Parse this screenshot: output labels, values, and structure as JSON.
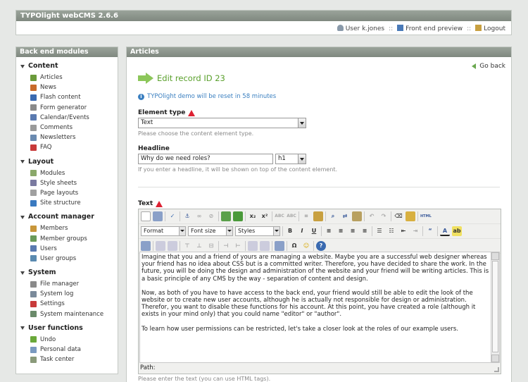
{
  "app": {
    "title": "TYPOlight webCMS 2.6.6"
  },
  "header": {
    "user_label": "User k.jones",
    "frontend_label": "Front end preview",
    "logout_label": "Logout",
    "sep": "::"
  },
  "sidebar": {
    "title": "Back end modules",
    "groups": [
      {
        "title": "Content",
        "items": [
          {
            "label": "Articles",
            "icon": "articles-icon",
            "color": "#6a9a3a"
          },
          {
            "label": "News",
            "icon": "news-icon",
            "color": "#c86a2a"
          },
          {
            "label": "Flash content",
            "icon": "flash-icon",
            "color": "#3a6ab0"
          },
          {
            "label": "Form generator",
            "icon": "form-icon",
            "color": "#8a8a8a"
          },
          {
            "label": "Calendar/Events",
            "icon": "calendar-icon",
            "color": "#5a7ab0"
          },
          {
            "label": "Comments",
            "icon": "comments-icon",
            "color": "#9a9a9a"
          },
          {
            "label": "Newsletters",
            "icon": "newsletter-icon",
            "color": "#6a8ab0"
          },
          {
            "label": "FAQ",
            "icon": "faq-icon",
            "color": "#c83a3a"
          }
        ]
      },
      {
        "title": "Layout",
        "items": [
          {
            "label": "Modules",
            "icon": "modules-icon",
            "color": "#8aa86a"
          },
          {
            "label": "Style sheets",
            "icon": "stylesheet-icon",
            "color": "#7a7aa0"
          },
          {
            "label": "Page layouts",
            "icon": "layout-icon",
            "color": "#a0a0a0"
          },
          {
            "label": "Site structure",
            "icon": "globe-icon",
            "color": "#3a7ac0"
          }
        ]
      },
      {
        "title": "Account manager",
        "items": [
          {
            "label": "Members",
            "icon": "member-icon",
            "color": "#c8963a"
          },
          {
            "label": "Member groups",
            "icon": "member-groups-icon",
            "color": "#6a9a5a"
          },
          {
            "label": "Users",
            "icon": "user-icon",
            "color": "#5a7ab0"
          },
          {
            "label": "User groups",
            "icon": "user-groups-icon",
            "color": "#5a8ab0"
          }
        ]
      },
      {
        "title": "System",
        "items": [
          {
            "label": "File manager",
            "icon": "folder-icon",
            "color": "#8a8a8a"
          },
          {
            "label": "System log",
            "icon": "log-icon",
            "color": "#7a8a9a"
          },
          {
            "label": "Settings",
            "icon": "settings-icon",
            "color": "#c83a3a"
          },
          {
            "label": "System maintenance",
            "icon": "maintenance-icon",
            "color": "#6a8a6a"
          }
        ]
      },
      {
        "title": "User functions",
        "items": [
          {
            "label": "Undo",
            "icon": "undo-icon",
            "color": "#6aa83a"
          },
          {
            "label": "Personal data",
            "icon": "personal-data-icon",
            "color": "#7a9ac0"
          },
          {
            "label": "Task center",
            "icon": "task-icon",
            "color": "#8a9a7a"
          }
        ]
      }
    ]
  },
  "main": {
    "title": "Articles",
    "goback_label": "Go back",
    "edit_title": "Edit record ID 23",
    "info_text": "TYPOlight demo will be reset in 58 minutes",
    "element_type": {
      "label": "Element type",
      "value": "Text",
      "hint": "Please choose the content element type."
    },
    "headline": {
      "label": "Headline",
      "value": "Why do we need roles?",
      "level": "h1",
      "hint": "If you enter a headline, it will be shown on top of the content element."
    },
    "text": {
      "label": "Text",
      "format_select": "Format",
      "fontsize_select": "Font size",
      "styles_select": "Styles",
      "paragraphs": [
        "Imagine that you and a friend of yours are managing a website. Maybe you are a successful web designer whereas your friend has no idea about CSS but is a committed writer. Therefore, you have decided to share the work. In the future, you will be doing the design and administration of the website and your friend will be writing articles. This is a basic principle of any CMS by the way - separation of content and design.",
        "Now, as both of you have to have access to the back end, your friend would still be able to edit the look of the website or to create new user accounts, although he is actually not responsible for design or administration. Therefor, you want to disable these functions for his account. At this point, you have created a role (although it exists in your mind only) that you could name \"editor\" or \"author\".",
        "To learn how user permissions can be restricted, let's take a closer look at the roles of our example users."
      ],
      "path_label": "Path:",
      "hint": "Please enter the text (you can use HTML tags)."
    }
  }
}
